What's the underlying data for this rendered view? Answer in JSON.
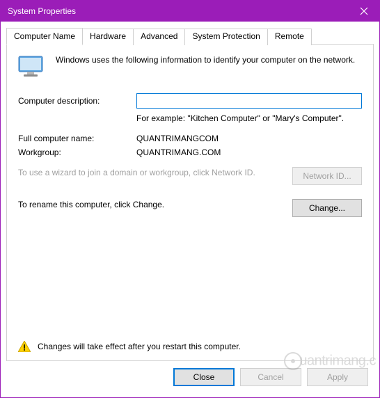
{
  "title": "System Properties",
  "tabs": [
    {
      "label": "Computer Name",
      "active": true
    },
    {
      "label": "Hardware",
      "active": false
    },
    {
      "label": "Advanced",
      "active": false
    },
    {
      "label": "System Protection",
      "active": false
    },
    {
      "label": "Remote",
      "active": false
    }
  ],
  "intro_text": "Windows uses the following information to identify your computer on the network.",
  "description": {
    "label": "Computer description:",
    "value": "",
    "example": "For example: \"Kitchen Computer\" or \"Mary's Computer\"."
  },
  "full_name": {
    "label": "Full computer name:",
    "value": "QUANTRIMANGCOM"
  },
  "workgroup": {
    "label": "Workgroup:",
    "value": "QUANTRIMANG.COM"
  },
  "network_id": {
    "text": "To use a wizard to join a domain or workgroup, click Network ID.",
    "button": "Network ID...",
    "enabled": false
  },
  "change": {
    "text": "To rename this computer, click Change.",
    "button": "Change...",
    "enabled": true
  },
  "warning": "Changes will take effect after you restart this computer.",
  "footer": {
    "close": "Close",
    "cancel": "Cancel",
    "apply": "Apply"
  },
  "watermark": "uantrimang.c"
}
